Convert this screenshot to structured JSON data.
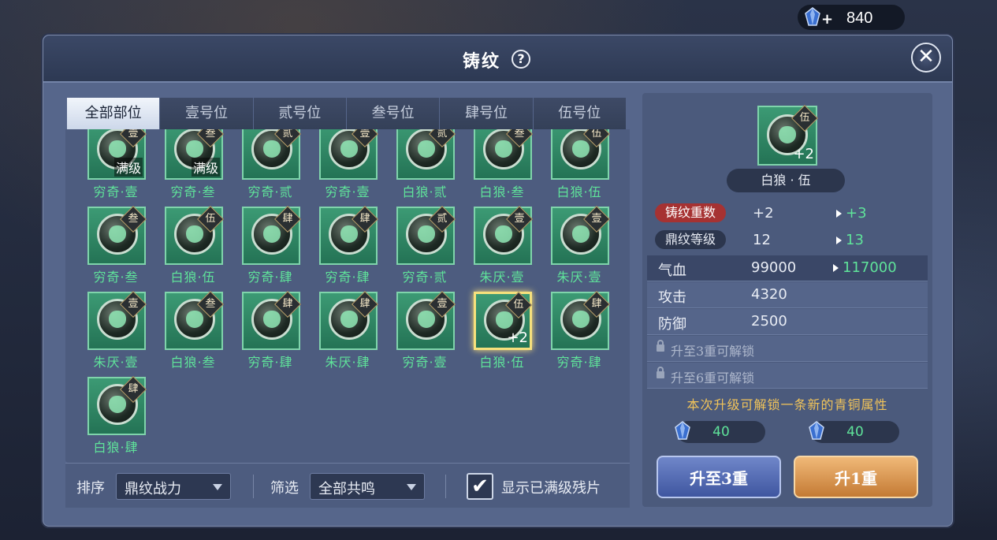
{
  "currency": {
    "value": "840",
    "icon": "gem-icon"
  },
  "dialog": {
    "title": "铸纹",
    "help": "?",
    "close": "✕"
  },
  "tabs": [
    "全部部位",
    "壹号位",
    "贰号位",
    "叁号位",
    "肆号位",
    "伍号位"
  ],
  "items": [
    {
      "name": "穷奇·壹",
      "rank": "壹",
      "badge": "满级"
    },
    {
      "name": "穷奇·叁",
      "rank": "叁",
      "badge": "满级"
    },
    {
      "name": "穷奇·贰",
      "rank": "贰",
      "badge": ""
    },
    {
      "name": "穷奇·壹",
      "rank": "壹",
      "badge": ""
    },
    {
      "name": "白狼·贰",
      "rank": "贰",
      "badge": ""
    },
    {
      "name": "白狼·叁",
      "rank": "叁",
      "badge": ""
    },
    {
      "name": "白狼·伍",
      "rank": "伍",
      "badge": ""
    },
    {
      "name": "穷奇·叁",
      "rank": "叁",
      "badge": ""
    },
    {
      "name": "白狼·伍",
      "rank": "伍",
      "badge": ""
    },
    {
      "name": "穷奇·肆",
      "rank": "肆",
      "badge": ""
    },
    {
      "name": "穷奇·肆",
      "rank": "肆",
      "badge": ""
    },
    {
      "name": "穷奇·贰",
      "rank": "贰",
      "badge": ""
    },
    {
      "name": "朱厌·壹",
      "rank": "壹",
      "badge": ""
    },
    {
      "name": "朱厌·壹",
      "rank": "壹",
      "badge": ""
    },
    {
      "name": "朱厌·壹",
      "rank": "壹",
      "badge": ""
    },
    {
      "name": "白狼·叁",
      "rank": "叁",
      "badge": ""
    },
    {
      "name": "穷奇·肆",
      "rank": "肆",
      "badge": ""
    },
    {
      "name": "朱厌·肆",
      "rank": "肆",
      "badge": ""
    },
    {
      "name": "穷奇·壹",
      "rank": "壹",
      "badge": ""
    },
    {
      "name": "白狼·伍",
      "rank": "伍",
      "badge": "+2",
      "selected": true
    },
    {
      "name": "穷奇·肆",
      "rank": "肆",
      "badge": ""
    },
    {
      "name": "白狼·肆",
      "rank": "肆",
      "badge": ""
    }
  ],
  "bottom": {
    "sort_label": "排序",
    "sort_value": "鼎纹战力",
    "filter_label": "筛选",
    "filter_value": "全部共鸣",
    "show_max_label": "显示已满级残片",
    "show_max_checked": "✔"
  },
  "detail": {
    "icon_rank": "伍",
    "icon_plus": "+2",
    "name": "白狼 · 伍",
    "stats": [
      {
        "label": "铸纹重数",
        "value": "+2",
        "next": "+3"
      },
      {
        "label": "鼎纹等级",
        "value": "12",
        "next": "13"
      }
    ],
    "attrs": [
      {
        "label": "气血",
        "value": "99000",
        "next": "117000"
      },
      {
        "label": "攻击",
        "value": "4320",
        "next": ""
      },
      {
        "label": "防御",
        "value": "2500",
        "next": ""
      }
    ],
    "locked": [
      "升至3重可解锁",
      "升至6重可解锁"
    ],
    "notice": "本次升级可解锁一条新的青铜属性",
    "costs": [
      "40",
      "40"
    ],
    "btn_upgrade_to": "升至3重",
    "btn_upgrade_one": "升1重"
  }
}
